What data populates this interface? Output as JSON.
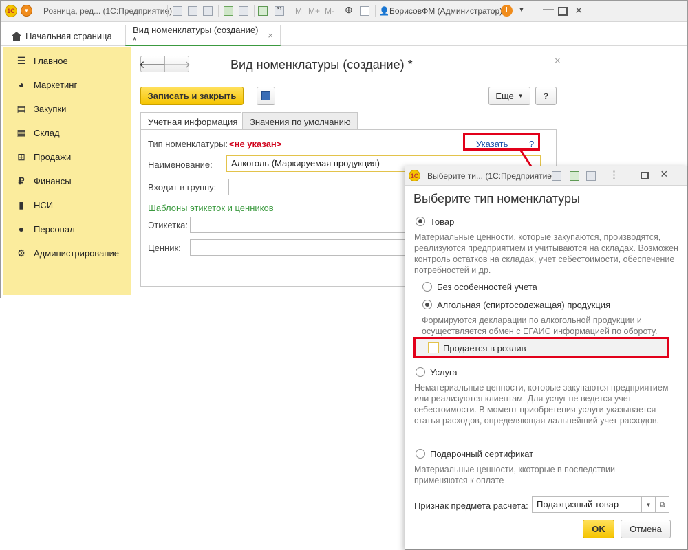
{
  "titlebar": {
    "app_title": "Розница, ред...  (1С:Предприятие)",
    "user": "БорисовФМ (Администратор)",
    "mem": [
      "M",
      "M+",
      "M-"
    ]
  },
  "tabs": {
    "home_label": "Начальная страница",
    "doc_label": "Вид номенклатуры  (создание) *",
    "close_glyph": "×"
  },
  "sidebar": {
    "items": [
      {
        "label": "Главное",
        "icon": "menu-lines-icon"
      },
      {
        "label": "Маркетинг",
        "icon": "pie-chart-icon"
      },
      {
        "label": "Закупки",
        "icon": "cart-icon"
      },
      {
        "label": "Склад",
        "icon": "warehouse-icon"
      },
      {
        "label": "Продажи",
        "icon": "basket-icon"
      },
      {
        "label": "Финансы",
        "icon": "ruble-icon"
      },
      {
        "label": "НСИ",
        "icon": "book-icon"
      },
      {
        "label": "Персонал",
        "icon": "person-icon"
      },
      {
        "label": "Администрирование",
        "icon": "gear-icon"
      }
    ]
  },
  "form": {
    "title": "Вид номенклатуры  (создание) *",
    "save_close": "Записать и закрыть",
    "more": "Еще",
    "help": "?",
    "tab_account": "Учетная информация",
    "tab_defaults": "Значения по умолчанию",
    "type_label": "Тип номенклатуры:",
    "type_value": "<не указан>",
    "specify_link": "Указать",
    "specify_help": "?",
    "name_label": "Наименование:",
    "name_value": "Алкоголь (Маркируемая продукция)",
    "group_label": "Входит в группу:",
    "templates_header": "Шаблоны этикеток и ценников",
    "label_label": "Этикетка:",
    "price_tag_label": "Ценник:"
  },
  "dialog": {
    "window_title": "Выберите ти...  (1С:Предприятие)",
    "heading": "Выберите тип номенклатуры",
    "opt_goods": "Товар",
    "opt_goods_desc": "Материальные ценности, которые закупаются, производятся, реализуются предприятием и учитываются на складах. Возможен контроль остатков на складах, учет себестоимости, обеспечение потребностей и др.",
    "sub_none": "Без особенностей учета",
    "sub_alcohol": "Алгольная (спиртосодежащая) продукция",
    "sub_alcohol_desc": "Формируются декларации по алкогольной продукции и осуществляется обмен с ЕГАИС информацией по обороту.",
    "draft_checkbox": "Продается в розлив",
    "opt_service": "Услуга",
    "opt_service_desc": "Нематериальные ценности, которые закупаются предприятием или реализуются клиентам. Для услуг не ведется учет себестоимости. В момент приобретения услуги указывается статья расходов, определяющая дальнейший учет расходов.",
    "opt_gift": "Подарочный сертификат",
    "opt_gift_desc": "Материальные ценности, ккоторые в последствии применяются к оплате",
    "subject_label": "Признак предмета расчета:",
    "subject_value": "Подакцизный товар",
    "ok": "OK",
    "cancel": "Отмена"
  },
  "colors": {
    "accent_yellow": "#f5c400",
    "sidebar_bg": "#fbec9d",
    "highlight_red": "#e2001a",
    "link_blue": "#1a4fa8",
    "group_green": "#3c9a40",
    "warning_red": "#d0021b"
  }
}
